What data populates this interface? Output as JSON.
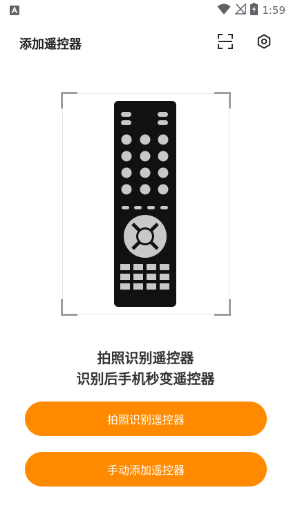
{
  "status_bar": {
    "time": "1:59",
    "icons": [
      "app-notification-icon",
      "wifi-icon",
      "no-signal-icon",
      "battery-charging-icon"
    ]
  },
  "header": {
    "title": "添加遥控器",
    "icons": [
      "scan-icon",
      "gear-icon"
    ]
  },
  "illustration": {
    "icon": "tv-remote-icon"
  },
  "headline": {
    "line1": "拍照识别遥控器",
    "line2": "识别后手机秒变遥控器"
  },
  "actions": {
    "photo_label": "拍照识别遥控器",
    "manual_label": "手动添加遥控器"
  },
  "colors": {
    "accent": "#ff8a00",
    "remote_body": "#111111",
    "remote_buttons": "#c8c8c8"
  }
}
